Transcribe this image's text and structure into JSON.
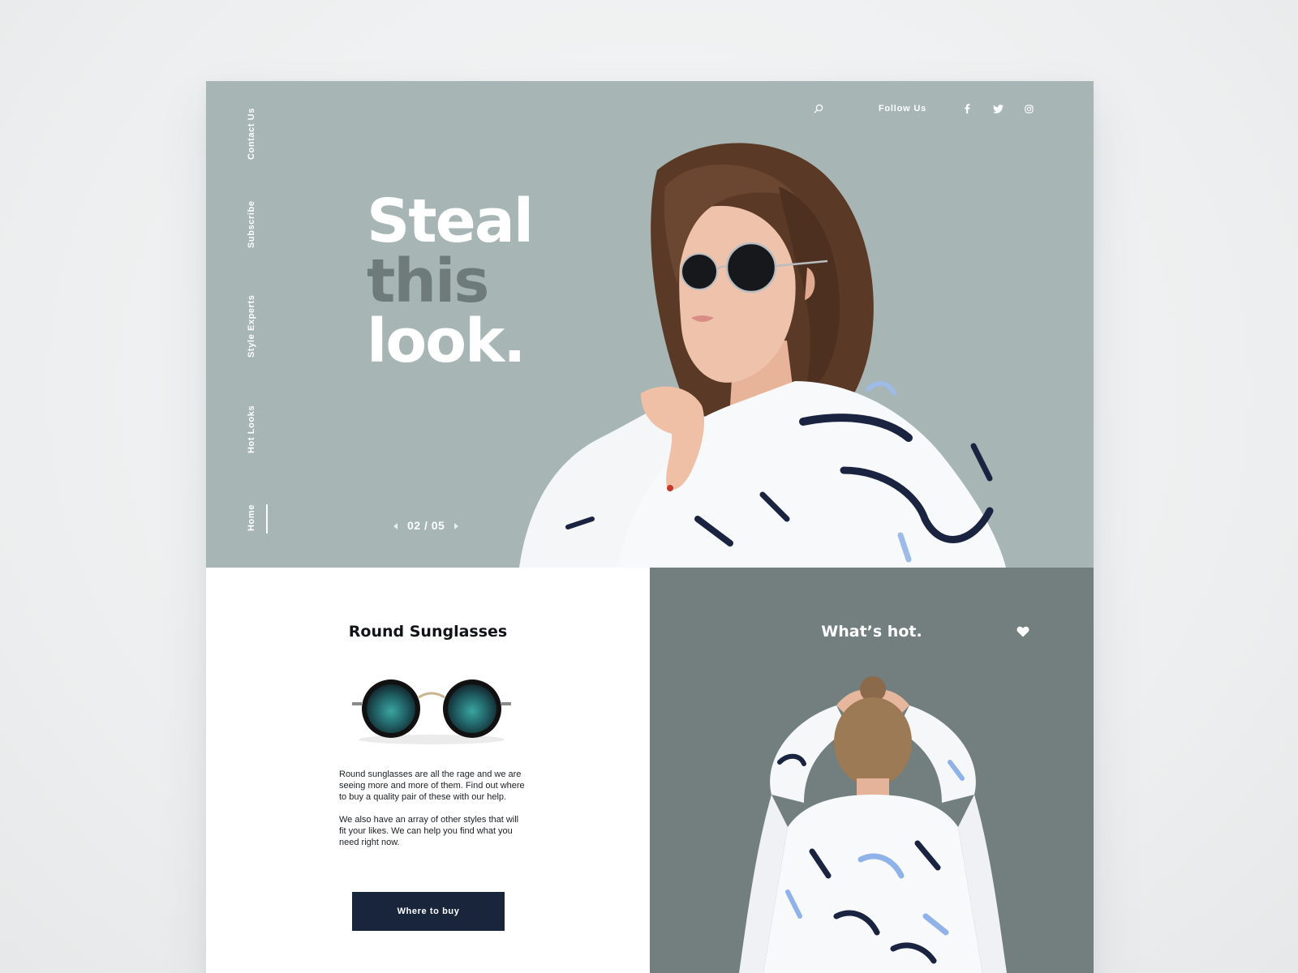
{
  "nav": {
    "items": [
      {
        "label": "Contact Us"
      },
      {
        "label": "Subscribe"
      },
      {
        "label": "Style Experts"
      },
      {
        "label": "Hot Looks"
      },
      {
        "label": "Home"
      }
    ],
    "active": "Home"
  },
  "header": {
    "follow_label": "Follow Us",
    "icons": [
      "search-icon",
      "facebook-icon",
      "twitter-icon",
      "instagram-icon"
    ]
  },
  "hero": {
    "headline_1": "Steal",
    "headline_2": "this",
    "headline_3": "look.",
    "pager": "02 / 05"
  },
  "product": {
    "title": "Round Sunglasses",
    "paragraph_1": "Round sunglasses are all the rage and we are seeing more and more of them.  Find out where to buy a quality pair of these with our help.",
    "paragraph_2": "We also have an array of other styles that will fit your likes.  We can help you find what you need right now.",
    "button_label": "Where to buy"
  },
  "hot": {
    "title": "What’s hot."
  },
  "colors": {
    "hero_bg": "#a7b5b4",
    "headline_accent": "#6e7b7a",
    "hot_bg": "#737f7e",
    "button_bg": "#18253b",
    "text_dark": "#111418"
  }
}
